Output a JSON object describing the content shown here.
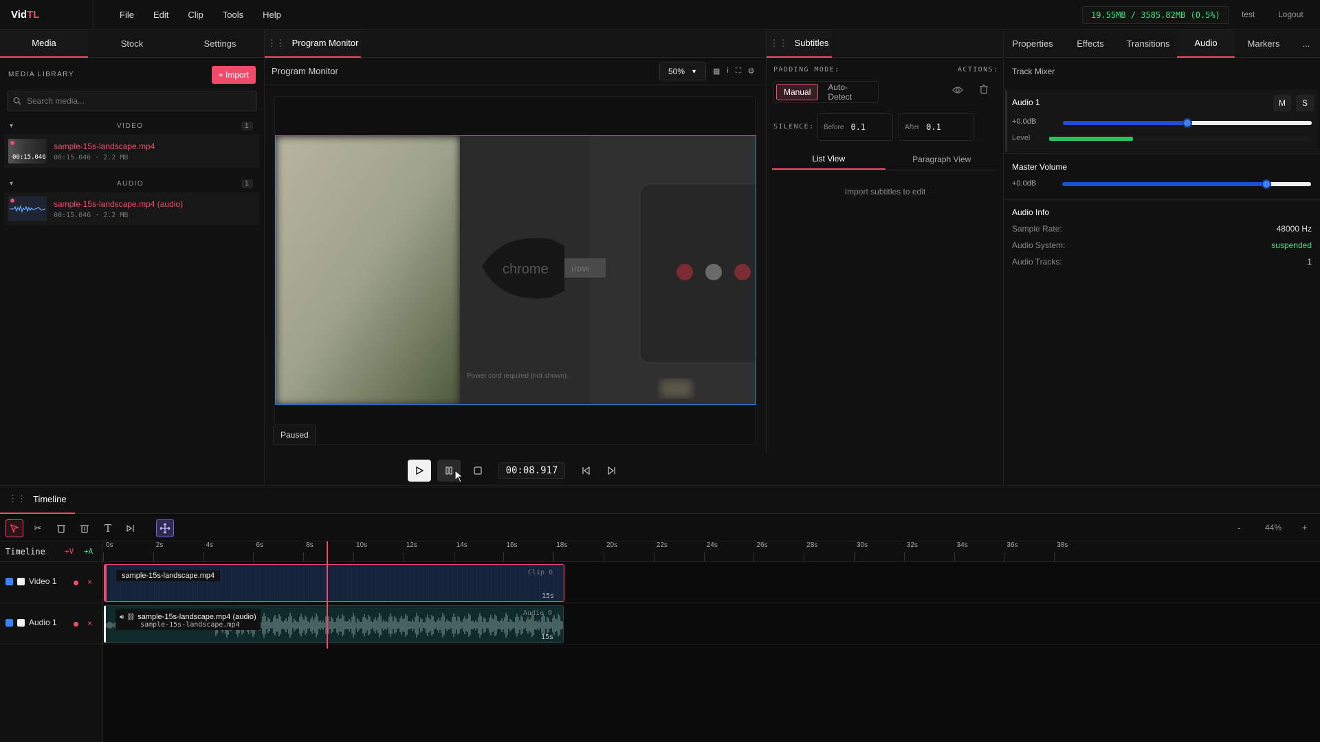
{
  "app": {
    "logo_main": "Vid",
    "logo_accent": "TL"
  },
  "menu": [
    "File",
    "Edit",
    "Clip",
    "Tools",
    "Help"
  ],
  "memory": "19.55MB / 3585.82MB (0.5%)",
  "user": {
    "name": "test",
    "logout": "Logout"
  },
  "left_tabs": [
    "Media",
    "Stock",
    "Settings"
  ],
  "media_library": {
    "title": "MEDIA LIBRARY",
    "import_label": "+ Import",
    "search_placeholder": "Search media...",
    "groups": [
      {
        "label": "VIDEO",
        "count": "1",
        "items": [
          {
            "name": "sample-15s-landscape.mp4",
            "meta": "00:15.046 · 2.2 MB",
            "thumb_duration": "00:15.046"
          }
        ]
      },
      {
        "label": "AUDIO",
        "count": "1",
        "items": [
          {
            "name": "sample-15s-landscape.mp4 (audio)",
            "meta": "00:15.046 · 2.2 MB"
          }
        ]
      }
    ]
  },
  "monitor": {
    "tab": "Program Monitor",
    "title": "Program Monitor",
    "zoom": "50%",
    "status": "Paused",
    "timecode": "00:08.917",
    "frame_caption": "Power cord required (not shown).",
    "frame_brand": "chrome",
    "frame_port": "HDMI"
  },
  "subtitles": {
    "tab": "Subtitles",
    "padding_label": "PADDING MODE:",
    "actions_label": "ACTIONS:",
    "mode_manual": "Manual",
    "mode_auto": "Auto-Detect",
    "silence_label": "SILENCE:",
    "before_label": "Before",
    "before_value": "0.1",
    "after_label": "After",
    "after_value": "0.1",
    "view_list": "List View",
    "view_paragraph": "Paragraph View",
    "empty": "Import subtitles to edit"
  },
  "right_tabs": [
    "Properties",
    "Effects",
    "Transitions",
    "Audio",
    "Markers",
    "..."
  ],
  "audio": {
    "mixer_title": "Track Mixer",
    "track_name": "Audio 1",
    "mute": "M",
    "solo": "S",
    "track_gain": "+0.0dB",
    "track_slider_fraction": 0.5,
    "level_label": "Level",
    "level_fraction": 0.32,
    "master_title": "Master Volume",
    "master_gain": "+0.0dB",
    "master_slider_fraction": 0.82,
    "info_title": "Audio Info",
    "info": [
      {
        "label": "Sample Rate:",
        "value": "48000 Hz"
      },
      {
        "label": "Audio System:",
        "value": "suspended"
      },
      {
        "label": "Audio Tracks:",
        "value": "1"
      }
    ],
    "colors": {
      "accent": "#f04b6a",
      "slider": "#3b82f6",
      "level": "#22c55e",
      "suspended": "#4ade80"
    }
  },
  "timeline": {
    "tab": "Timeline",
    "label": "Timeline",
    "add_video": "+V",
    "add_audio": "+A",
    "zoom_minus": "-",
    "zoom": "44%",
    "zoom_plus": "+",
    "ruler": [
      "0s",
      "2s",
      "4s",
      "6s",
      "8s",
      "10s",
      "12s",
      "14s",
      "16s",
      "18s",
      "20s",
      "22s",
      "24s",
      "26s",
      "28s",
      "30s",
      "32s",
      "34s",
      "36s",
      "38s"
    ],
    "playhead_seconds": 8.917,
    "tracks": [
      {
        "name": "Video 1",
        "clip_title": "sample-15s-landscape.mp4",
        "clip_id": "Clip 0",
        "clip_len": "15s"
      },
      {
        "name": "Audio 1",
        "clip_title": "sample-15s-landscape.mp4 (audio)",
        "clip_sub": "sample-15s-landscape.mp4",
        "clip_id": "Audio 0",
        "clip_len": "15s"
      }
    ]
  }
}
